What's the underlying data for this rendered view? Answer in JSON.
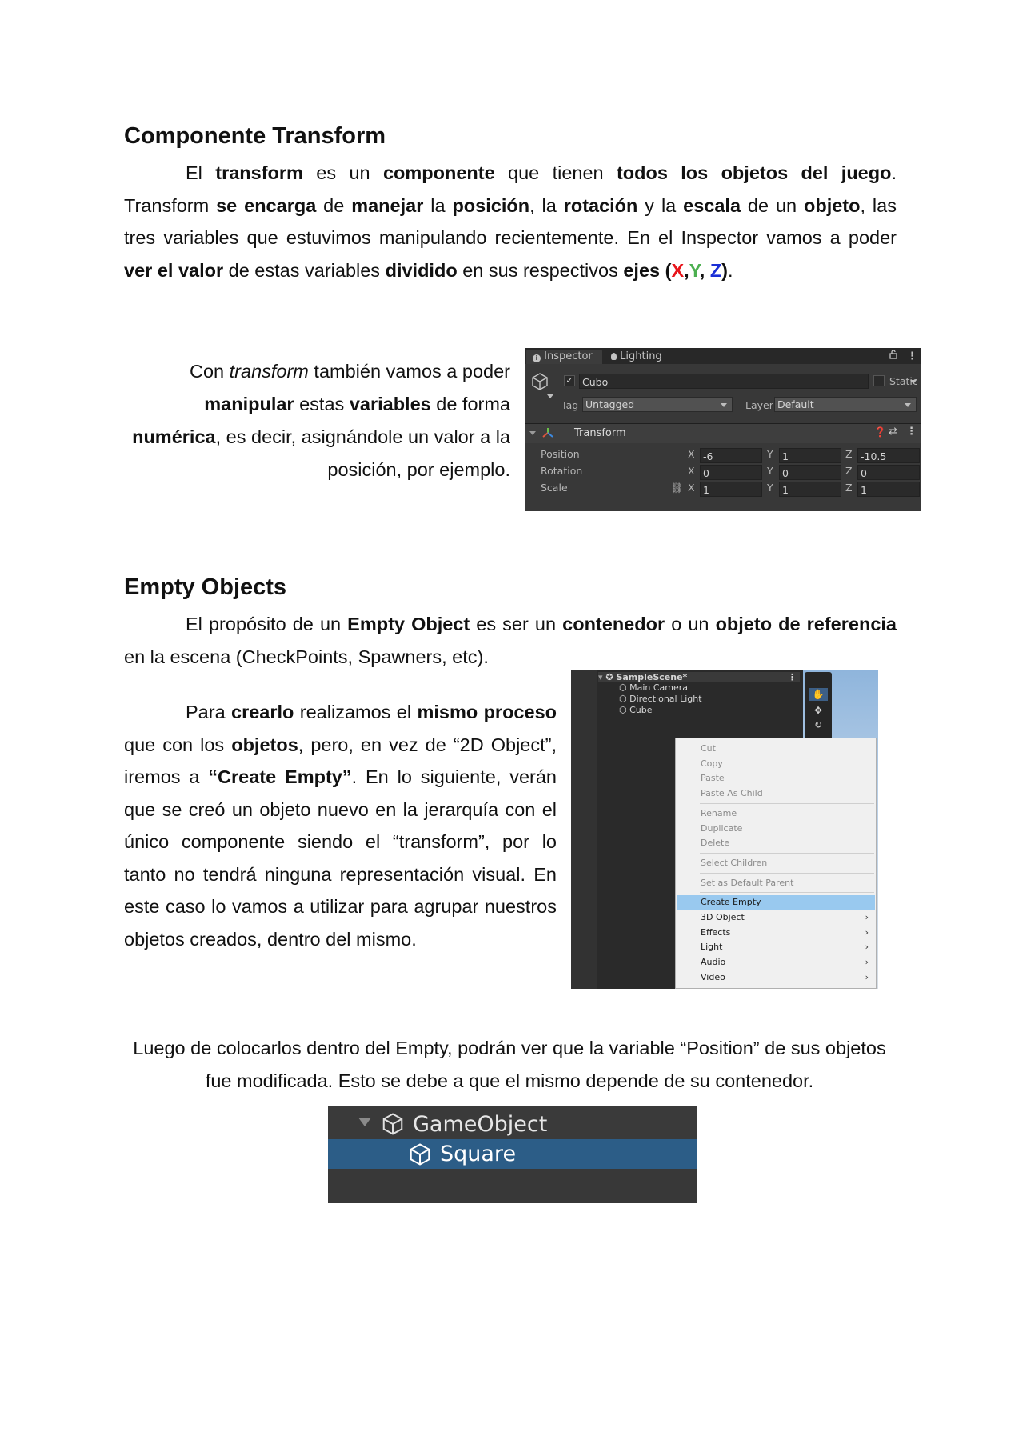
{
  "section1": {
    "heading": "Componente Transform",
    "para1": [
      {
        "t": "El "
      },
      {
        "t": "transform",
        "b": true
      },
      {
        "t": " es un "
      },
      {
        "t": "componente",
        "b": true
      },
      {
        "t": " que tienen "
      },
      {
        "t": "todos los objetos del juego",
        "b": true
      },
      {
        "t": ". Transform "
      },
      {
        "t": "se encarga",
        "b": true
      },
      {
        "t": " de "
      },
      {
        "t": "manejar",
        "b": true
      },
      {
        "t": " la "
      },
      {
        "t": "posición",
        "b": true
      },
      {
        "t": ", la "
      },
      {
        "t": "rotación",
        "b": true
      },
      {
        "t": " y la "
      },
      {
        "t": "escala",
        "b": true
      },
      {
        "t": " de un "
      },
      {
        "t": "objeto",
        "b": true
      },
      {
        "t": ", las tres variables que estuvimos manipulando recientemente. En el Inspector vamos a poder "
      },
      {
        "t": "ver el valor",
        "b": true
      },
      {
        "t": " de estas variables "
      },
      {
        "t": "dividido",
        "b": true
      },
      {
        "t": " en sus respectivos "
      },
      {
        "t": "ejes (",
        "b": true
      },
      {
        "t": "X",
        "b": true,
        "c": "red"
      },
      {
        "t": ",",
        "b": true
      },
      {
        "t": "Y",
        "b": true,
        "c": "green"
      },
      {
        "t": ", ",
        "b": true
      },
      {
        "t": "Z",
        "b": true,
        "c": "blue"
      },
      {
        "t": ")",
        "b": true
      },
      {
        "t": "."
      }
    ],
    "side_para_lines": [
      [
        {
          "t": "Con "
        },
        {
          "t": "transform",
          "i": true
        },
        {
          "t": " también vamos a poder"
        }
      ],
      [
        {
          "t": "manipular",
          "b": true
        },
        {
          "t": " estas "
        },
        {
          "t": "variables",
          "b": true
        },
        {
          "t": " de forma"
        }
      ],
      [
        {
          "t": "numérica",
          "b": true
        },
        {
          "t": ", es decir, asignándole un valor a la"
        }
      ],
      [
        {
          "t": "posición, por ejemplo."
        }
      ]
    ]
  },
  "inspector": {
    "tab_inspector": "Inspector",
    "tab_lighting": "Lighting",
    "object_name": "Cubo",
    "static_label": "Static",
    "tag_label": "Tag",
    "tag_value": "Untagged",
    "layer_label": "Layer",
    "layer_value": "Default",
    "component_title": "Transform",
    "rows": [
      {
        "label": "Position",
        "x": "-6",
        "y": "1",
        "z": "-10.5"
      },
      {
        "label": "Rotation",
        "x": "0",
        "y": "0",
        "z": "0"
      },
      {
        "label": "Scale",
        "x": "1",
        "y": "1",
        "z": "1"
      }
    ],
    "axis_x": "X",
    "axis_y": "Y",
    "axis_z": "Z"
  },
  "section2": {
    "heading": "Empty Objects",
    "para1": [
      {
        "t": "El propósito de un "
      },
      {
        "t": "Empty Object",
        "b": true
      },
      {
        "t": " es ser un "
      },
      {
        "t": "contenedor",
        "b": true
      },
      {
        "t": " o un "
      },
      {
        "t": "objeto de referencia",
        "b": true
      },
      {
        "t": " en la escena (CheckPoints, Spawners, etc)."
      }
    ],
    "para2": [
      {
        "t": "Para "
      },
      {
        "t": "crearlo",
        "b": true
      },
      {
        "t": " realizamos el "
      },
      {
        "t": "mismo proceso",
        "b": true
      },
      {
        "t": " que con los "
      },
      {
        "t": "objetos",
        "b": true
      },
      {
        "t": ", pero, en vez de “2D Object”, iremos a "
      },
      {
        "t": "“Create Empty”",
        "b": true
      },
      {
        "t": ". En lo siguiente, verán que se creó un objeto nuevo en la jerarquía con el único componente siendo el “transform”, por lo tanto no tendrá ninguna representación visual. En este caso lo vamos a utilizar para agrupar nuestros objetos creados, dentro del mismo."
      }
    ],
    "para3_lines": [
      "Luego de colocarlos dentro del Empty, podrán ver que la variable “Position” de sus objetos",
      "fue modificada. Esto se debe a que el mismo depende de su contenedor."
    ]
  },
  "hierarchy": {
    "scene": "SampleScene*",
    "items": [
      "Main Camera",
      "Directional Light",
      "Cube"
    ]
  },
  "context_menu": {
    "groups": [
      [
        {
          "label": "Cut",
          "dis": true
        },
        {
          "label": "Copy",
          "dis": true
        },
        {
          "label": "Paste",
          "dis": true
        },
        {
          "label": "Paste As Child",
          "dis": true
        }
      ],
      [
        {
          "label": "Rename",
          "dis": true
        },
        {
          "label": "Duplicate",
          "dis": true
        },
        {
          "label": "Delete",
          "dis": true
        }
      ],
      [
        {
          "label": "Select Children",
          "dis": true
        }
      ],
      [
        {
          "label": "Set as Default Parent",
          "dis": true
        }
      ],
      [
        {
          "label": "Create Empty",
          "sel": true
        },
        {
          "label": "3D Object",
          "sub": true
        },
        {
          "label": "Effects",
          "sub": true
        },
        {
          "label": "Light",
          "sub": true
        },
        {
          "label": "Audio",
          "sub": true
        },
        {
          "label": "Video",
          "sub": true
        }
      ]
    ]
  },
  "gameobject_view": {
    "parent": "GameObject",
    "child": "Square",
    "selection_color": "#2c5d87"
  }
}
